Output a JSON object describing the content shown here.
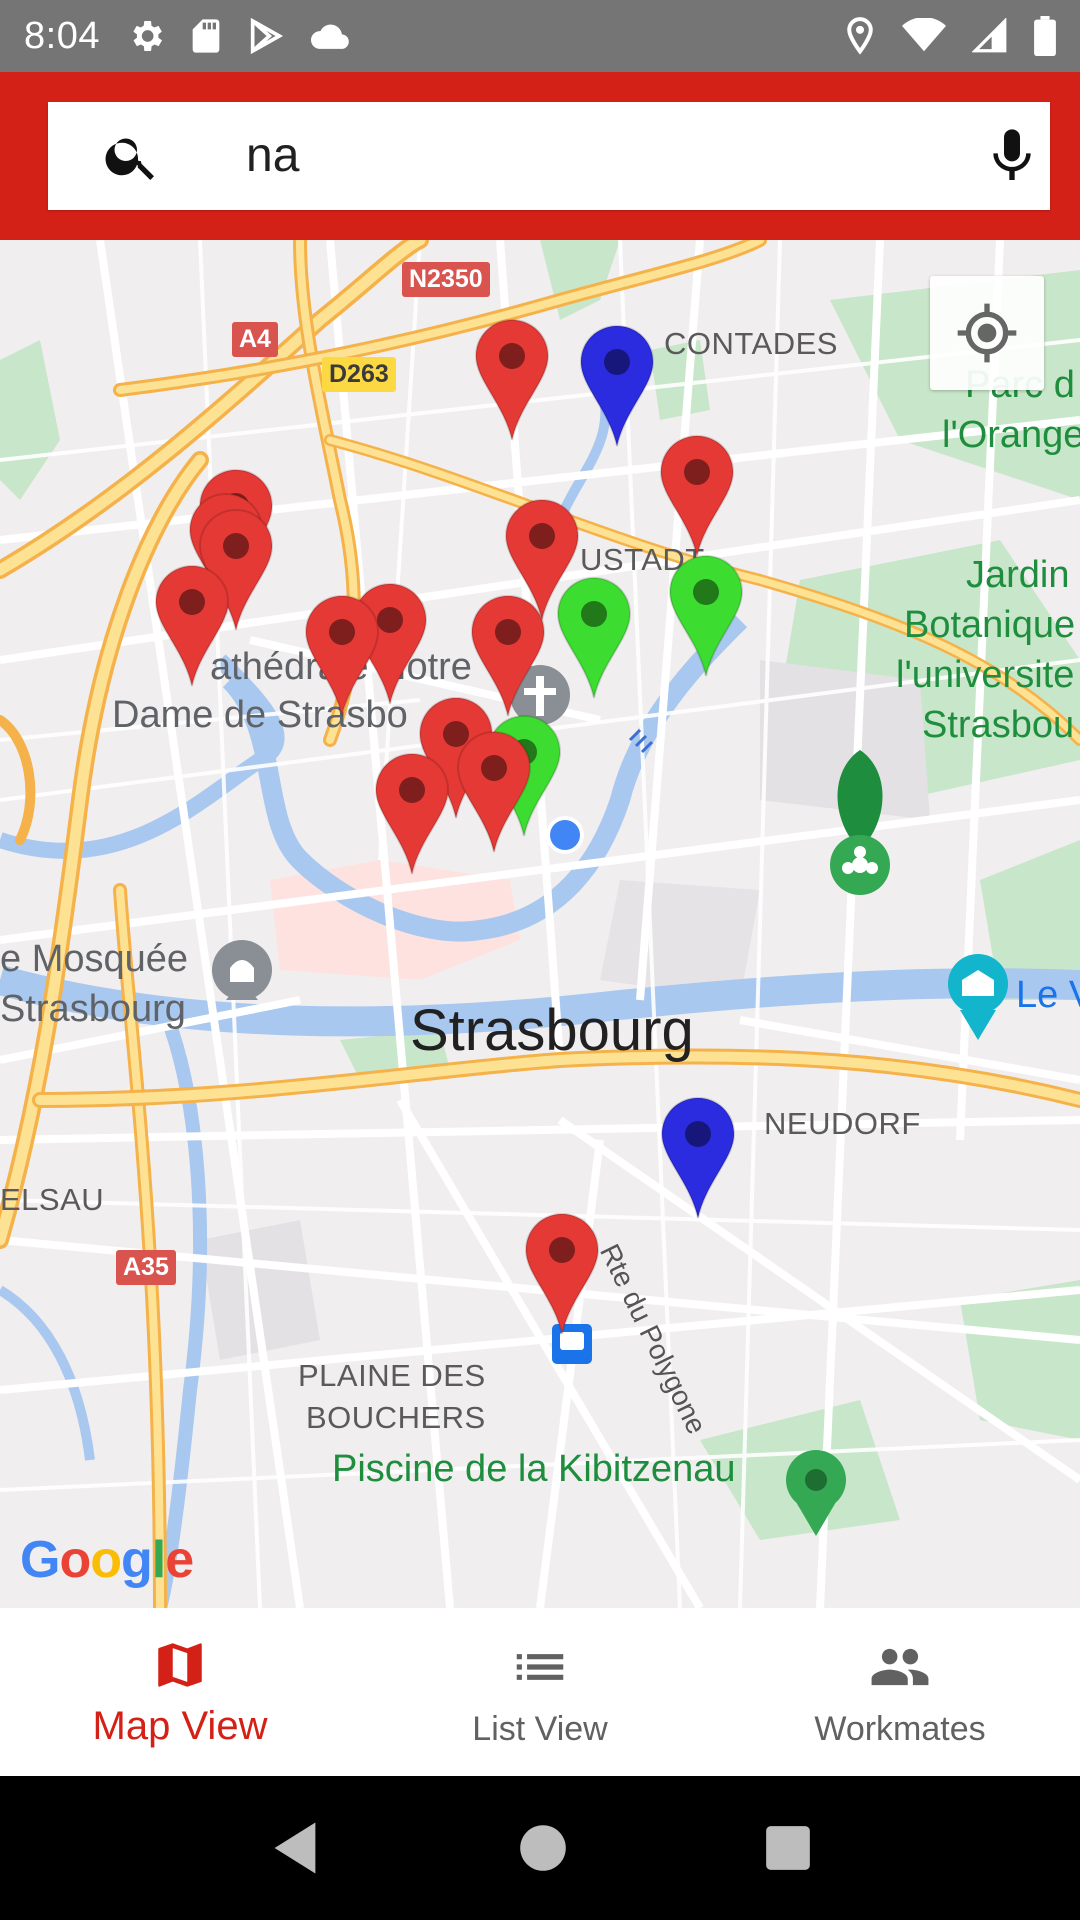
{
  "status_bar": {
    "time": "8:04",
    "left_icons": [
      "settings-icon",
      "sd-card-icon",
      "play-store-icon",
      "cloud-icon"
    ],
    "right_icons": [
      "location-icon",
      "wifi-icon",
      "signal-icon",
      "battery-icon"
    ]
  },
  "header": {
    "background_color": "#d32117",
    "search": {
      "value": "na",
      "icon": "search-icon",
      "voice_icon": "mic-icon"
    }
  },
  "map": {
    "provider_logo": "Google",
    "locate_icon": "my-location-icon",
    "road_badges": [
      "N2350",
      "A4",
      "D263",
      "A35"
    ],
    "labels": {
      "contades": "CONTADES",
      "parc_line1": "Parc d",
      "parc_line2": "l'Orange",
      "neustadt": "USTADT",
      "jardin_line1": "Jardin",
      "jardin_line2": "Botanique",
      "jardin_line3": "l'universite",
      "jardin_line4": "Strasbou",
      "cathedrale_line1": "athédrale Notre",
      "cathedrale_line2": "Dame de Strasbo",
      "mosquee_line1": "e Mosquée",
      "mosquee_line2": "Strasbourg",
      "city": "Strasbourg",
      "le_v": "Le V",
      "neudorf": "NEUDORF",
      "elsau": "ELSAU",
      "rte_polygone": "Rte du Polygone",
      "plaine_line1": "PLAINE DES",
      "plaine_line2": "BOUCHERS",
      "piscine": "Piscine de la Kibitzenau"
    },
    "marker_colors": {
      "red": "#e53935",
      "green": "#3ddc31",
      "blue": "#2b2be0"
    }
  },
  "bottom_nav": {
    "items": [
      {
        "label": "Map View",
        "icon": "map-icon",
        "active": true
      },
      {
        "label": "List View",
        "icon": "list-icon",
        "active": false
      },
      {
        "label": "Workmates",
        "icon": "people-icon",
        "active": false
      }
    ]
  },
  "system_nav": {
    "buttons": [
      "back-icon",
      "home-icon",
      "recents-icon"
    ]
  }
}
